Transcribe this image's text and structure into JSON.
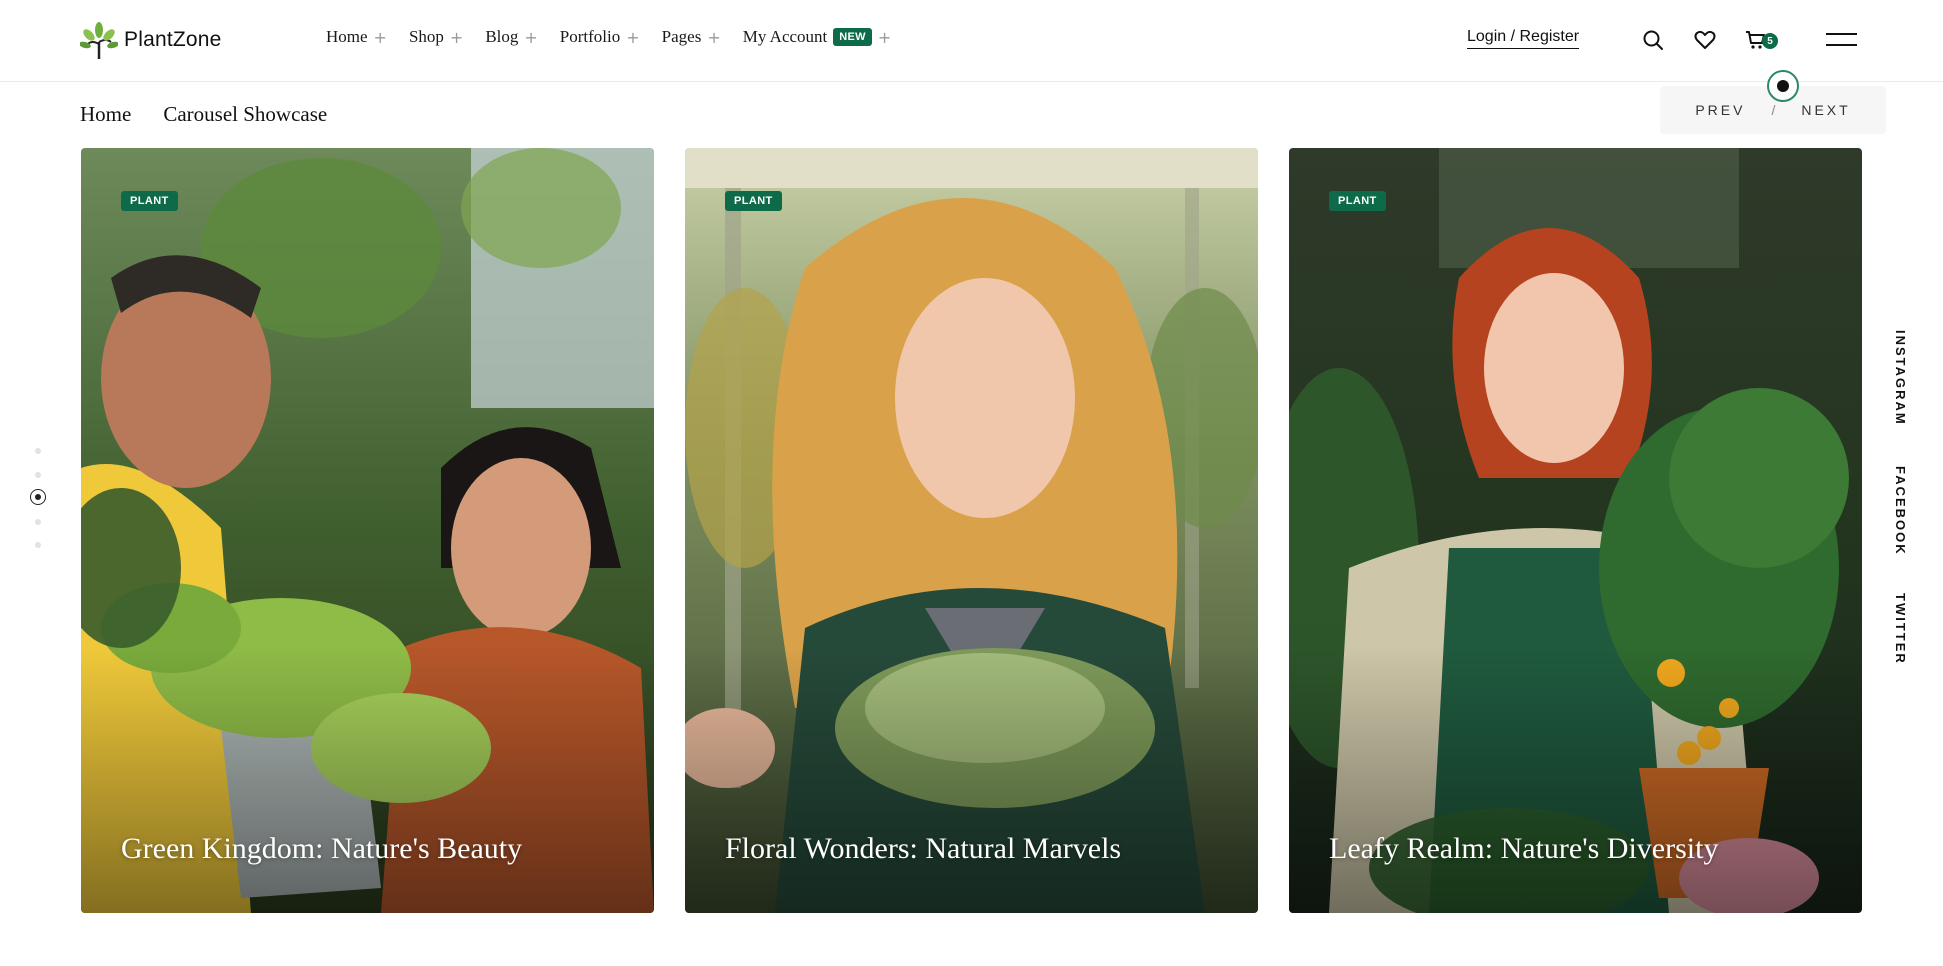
{
  "brand": {
    "name": "PlantZone",
    "logo_icon": "tree-leaf-logo"
  },
  "nav": {
    "items": [
      {
        "label": "Home",
        "expand_icon": "plus-icon"
      },
      {
        "label": "Shop",
        "expand_icon": "plus-icon"
      },
      {
        "label": "Blog",
        "expand_icon": "plus-icon"
      },
      {
        "label": "Portfolio",
        "expand_icon": "plus-icon"
      },
      {
        "label": "Pages",
        "expand_icon": "plus-icon"
      },
      {
        "label": "My Account",
        "badge": "NEW",
        "expand_icon": "plus-icon"
      }
    ],
    "expand_glyph": "+"
  },
  "header_actions": {
    "login_label": "Login / Register",
    "icons": [
      "search-icon",
      "heart-icon",
      "cart-icon",
      "hamburger-menu-icon"
    ],
    "cart_count": "5"
  },
  "breadcrumb": {
    "home": "Home",
    "current": "Carousel Showcase"
  },
  "pager": {
    "prev": "PREV",
    "separator": "/",
    "next": "NEXT"
  },
  "carousel_dots": {
    "count": 5,
    "active_index": 2
  },
  "social": {
    "instagram": "INSTAGRAM",
    "facebook": "FACEBOOK",
    "twitter": "TWITTER"
  },
  "cards": [
    {
      "tag": "PLANT",
      "title": "Green Kingdom: Nature's Beauty"
    },
    {
      "tag": "PLANT",
      "title": "Floral Wonders: Natural Marvels"
    },
    {
      "tag": "PLANT",
      "title": "Leafy Realm: Nature's Diversity"
    }
  ],
  "colors": {
    "accent": "#0e6b4a",
    "text": "#111111",
    "border": "#e9e9e9"
  }
}
